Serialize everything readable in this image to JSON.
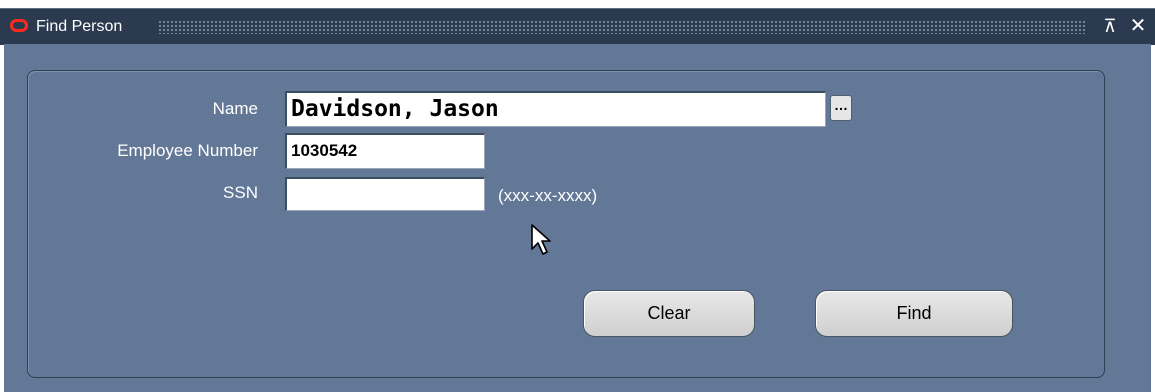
{
  "window": {
    "title": "Find Person",
    "restore_glyph": "⊼",
    "close_glyph": "✕"
  },
  "form": {
    "name": {
      "label": "Name",
      "value": "Davidson, Jason",
      "lov_glyph": "…"
    },
    "employee_number": {
      "label": "Employee Number",
      "value": "1030542"
    },
    "ssn": {
      "label": "SSN",
      "value": "",
      "format_hint": "(xxx-xx-xxxx)"
    }
  },
  "buttons": {
    "clear": "Clear",
    "find": "Find"
  },
  "icons": {
    "app_logo": "oracle-logo-icon",
    "restore": "restore-icon",
    "close": "close-icon",
    "lov": "list-of-values-icon",
    "pointer": "mouse-pointer-icon"
  },
  "colors": {
    "titlebar": "#2b3a4e",
    "client_background": "#627896",
    "logo_accent": "#ff2a1f"
  }
}
